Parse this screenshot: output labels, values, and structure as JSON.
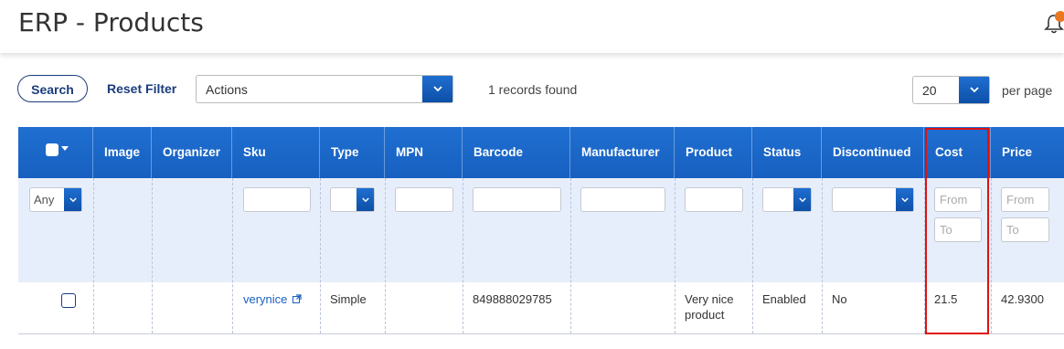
{
  "header": {
    "title": "ERP - Products"
  },
  "toolbar": {
    "search_label": "Search",
    "reset_label": "Reset Filter",
    "actions_value": "Actions",
    "records_text": "1 records found",
    "per_page_value": "20",
    "per_page_label": "per page"
  },
  "table": {
    "columns": [
      "Image",
      "Organizer",
      "Sku",
      "Type",
      "MPN",
      "Barcode",
      "Manufacturer",
      "Product",
      "Status",
      "Discontinued",
      "Cost",
      "Price"
    ],
    "filters": {
      "checkbox_any": "Any",
      "cost_from": "From",
      "cost_to": "To",
      "price_from": "From",
      "price_to": "To"
    },
    "rows": [
      {
        "sku": "verynice",
        "type": "Simple",
        "barcode": "849888029785",
        "product_line1": "Very nice",
        "product_line2": "product",
        "status": "Enabled",
        "discontinued": "No",
        "cost": "21.5",
        "price": "42.9300"
      }
    ]
  },
  "colors": {
    "header_blue": "#1f6fd1",
    "filter_bg": "#e7eefb",
    "highlight": "#e01010",
    "badge": "#e87722"
  }
}
